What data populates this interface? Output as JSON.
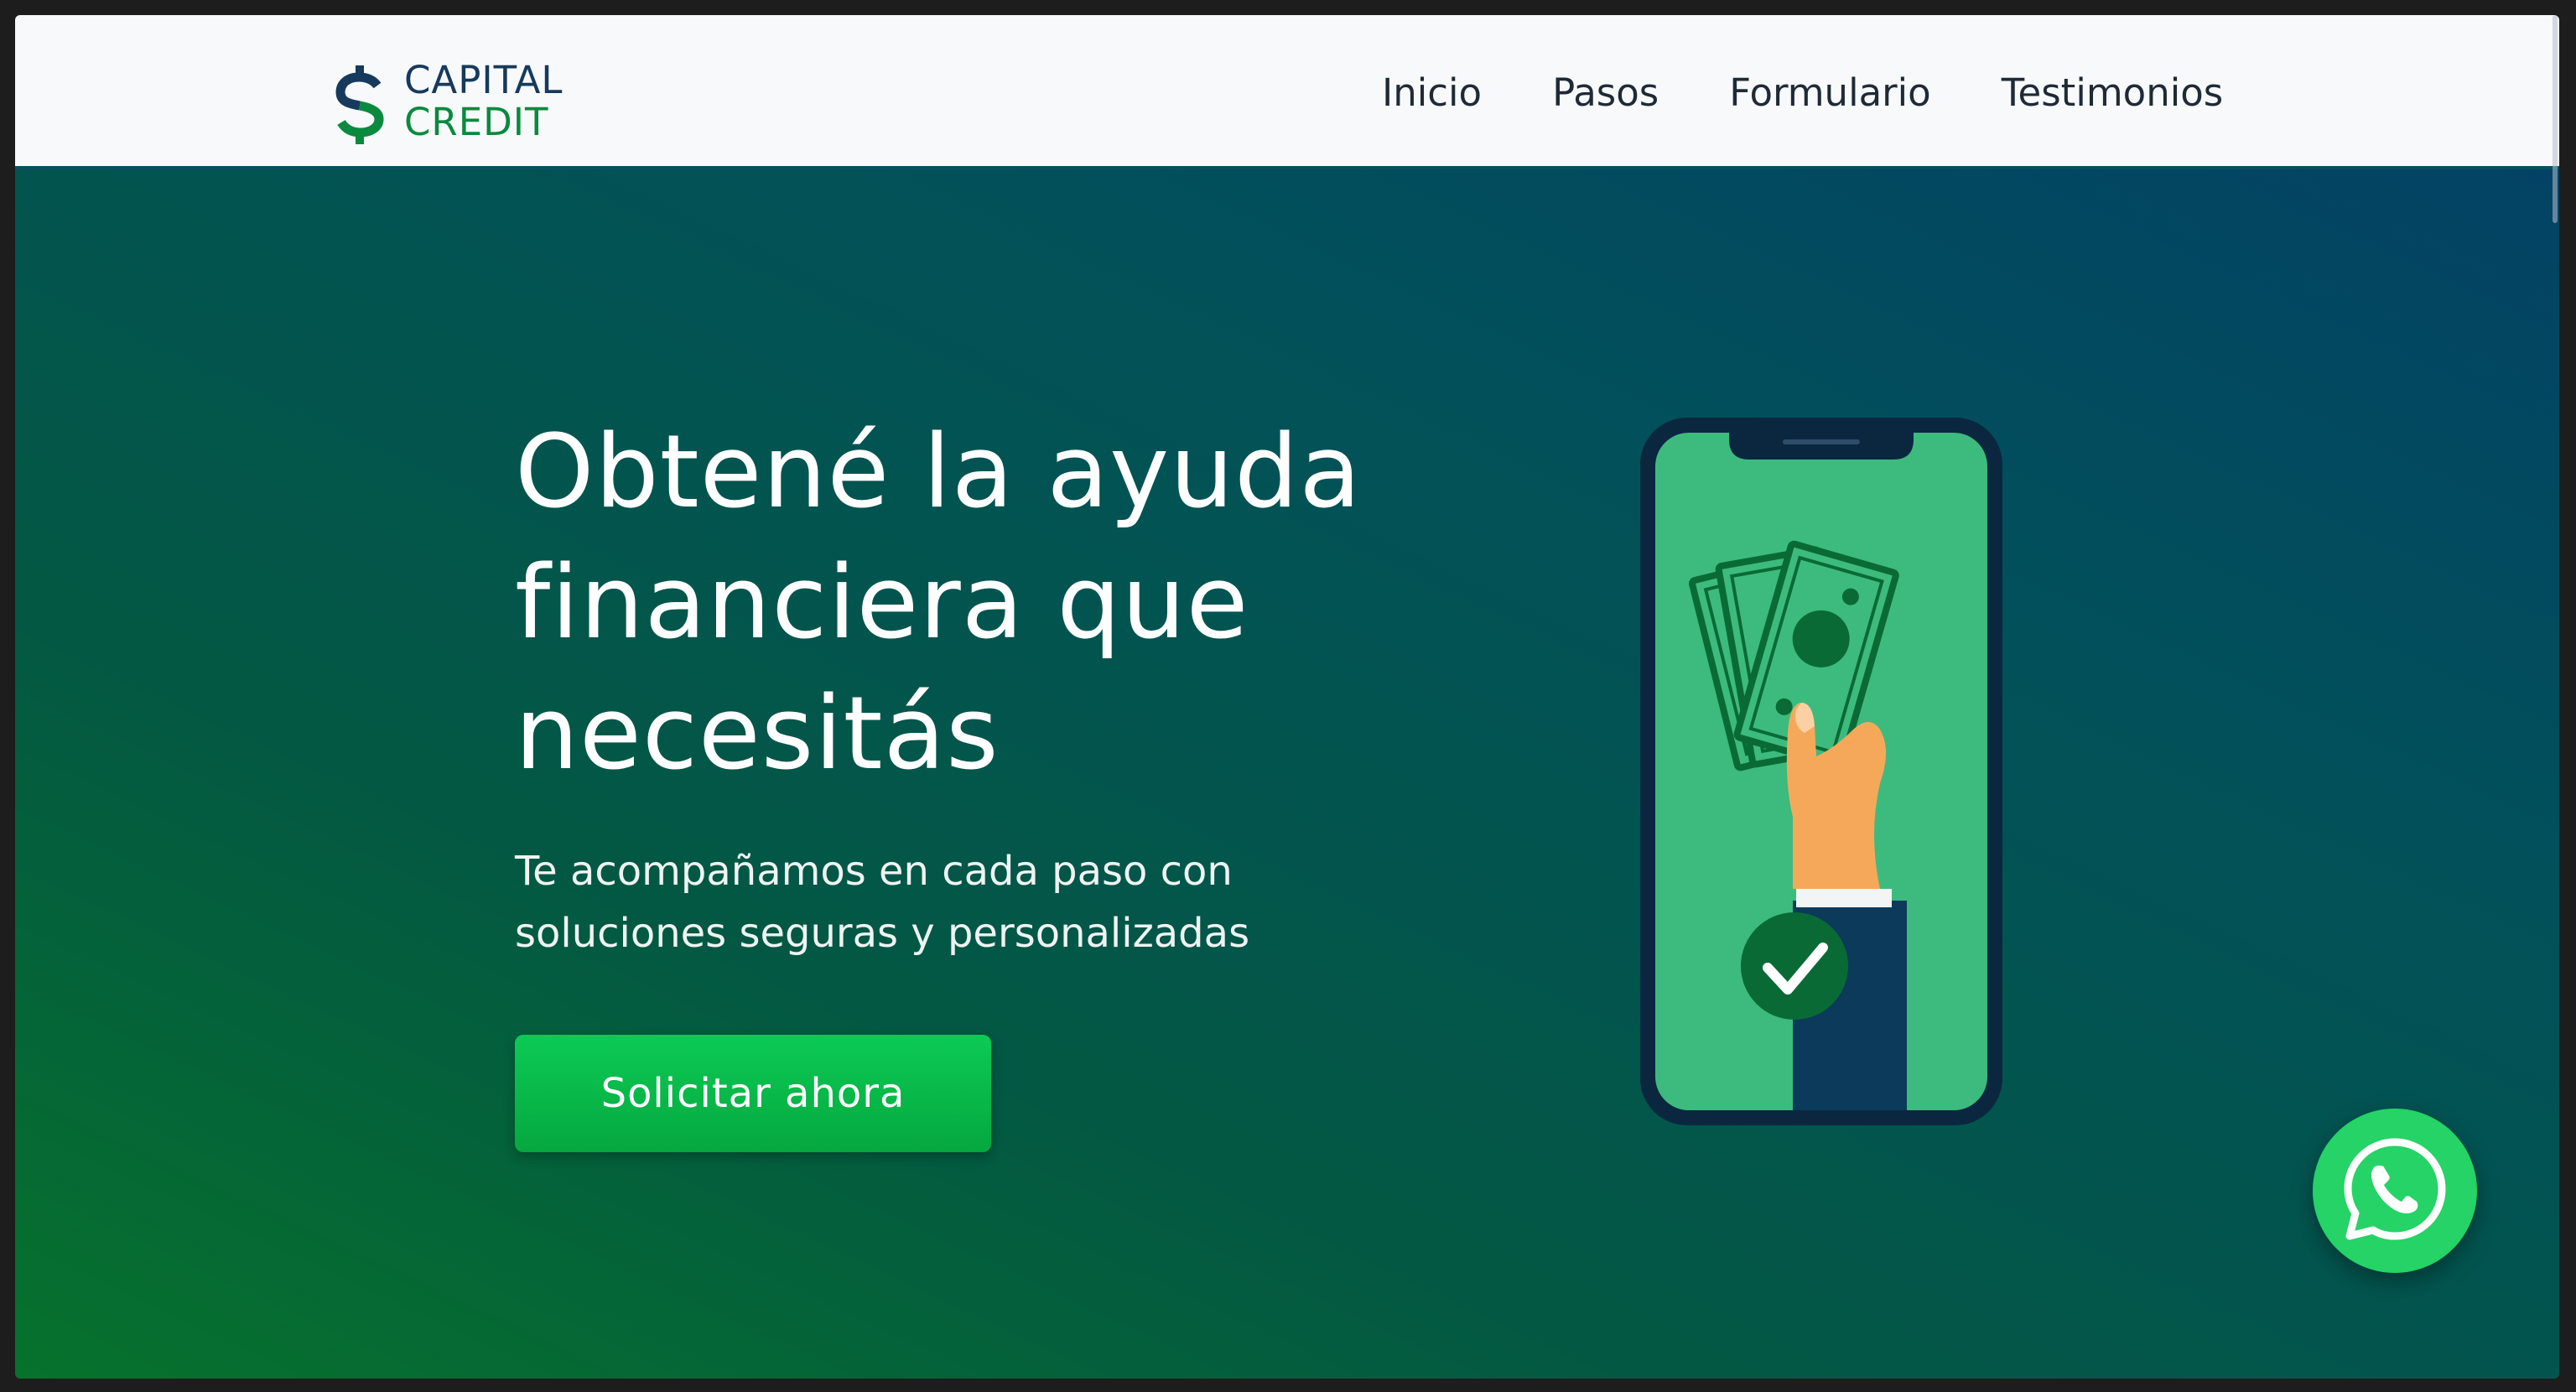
{
  "brand": {
    "line1": "CAPITAL",
    "line2": "CREDIT",
    "icon": "dollar-sign-icon",
    "colors": {
      "primary": "#163a5c",
      "accent": "#0a8a3e"
    }
  },
  "nav": {
    "items": [
      {
        "label": "Inicio"
      },
      {
        "label": "Pasos"
      },
      {
        "label": "Formulario"
      },
      {
        "label": "Testimonios"
      }
    ]
  },
  "hero": {
    "title": "Obtené la ayuda financiera que necesitás",
    "subtitle": "Te acompañamos en cada paso con soluciones seguras y personalizadas",
    "cta_label": "Solicitar ahora",
    "illustration": "phone-hand-money-illustration",
    "colors": {
      "cta": "#05b844",
      "background_start": "#033f67",
      "background_end": "#06722c"
    }
  },
  "floating": {
    "whatsapp_icon": "whatsapp-icon",
    "color": "#25d366"
  }
}
